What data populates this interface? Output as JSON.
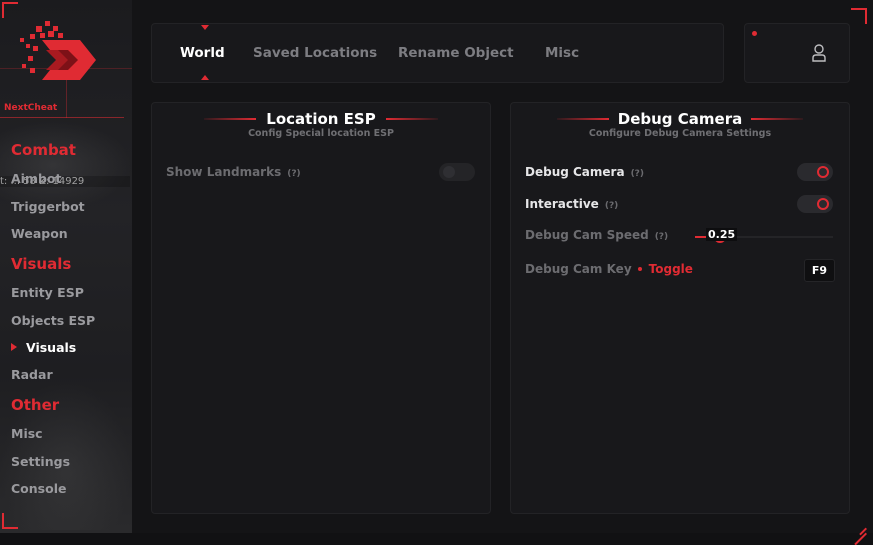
{
  "app": {
    "brand": "NextCheat"
  },
  "background_text": "t: ... 58 Z: 14929",
  "sidebar": {
    "groups": [
      {
        "label": "Combat",
        "items": [
          {
            "label": "Aimbot"
          },
          {
            "label": "Triggerbot"
          },
          {
            "label": "Weapon"
          }
        ]
      },
      {
        "label": "Visuals",
        "items": [
          {
            "label": "Entity ESP"
          },
          {
            "label": "Objects ESP"
          },
          {
            "label": "Visuals",
            "active": true
          },
          {
            "label": "Radar"
          }
        ]
      },
      {
        "label": "Other",
        "items": [
          {
            "label": "Misc"
          },
          {
            "label": "Settings"
          },
          {
            "label": "Console"
          }
        ]
      }
    ]
  },
  "tabs": [
    {
      "label": "World",
      "active": true
    },
    {
      "label": "Saved Locations"
    },
    {
      "label": "Rename Object"
    },
    {
      "label": "Misc"
    }
  ],
  "location_esp": {
    "title": "Location ESP",
    "subtitle": "Config Special location ESP",
    "show_landmarks": {
      "label": "Show Landmarks",
      "help": "(?)",
      "enabled": false
    }
  },
  "debug_camera": {
    "title": "Debug Camera",
    "subtitle": "Configure Debug Camera Settings",
    "debug_camera": {
      "label": "Debug Camera",
      "help": "(?)",
      "enabled": true
    },
    "interactive": {
      "label": "Interactive",
      "help": "(?)",
      "enabled": true
    },
    "speed": {
      "label": "Debug Cam Speed",
      "help": "(?)",
      "value": "0.25",
      "fraction": 0.18
    },
    "key": {
      "label": "Debug Cam Key",
      "mode": "Toggle",
      "key": "F9"
    }
  },
  "colors": {
    "accent": "#e02b33",
    "panel": "#18181b",
    "background": "#141416",
    "text_dim": "#6c6c70",
    "text_bright": "#e6e6e8"
  },
  "icons": {
    "logo": "nextcheat-logo",
    "user": "user-icon"
  }
}
